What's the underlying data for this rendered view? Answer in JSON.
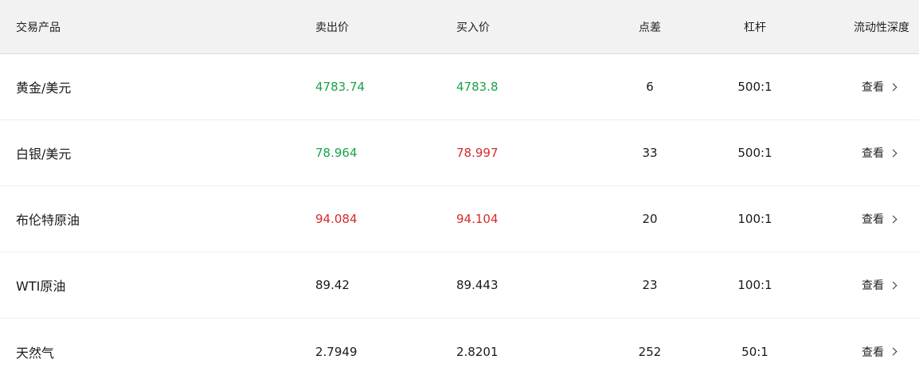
{
  "header": {
    "product": "交易产品",
    "sell": "卖出价",
    "buy": "买入价",
    "spread": "点差",
    "leverage": "杠杆",
    "depth": "流动性深度"
  },
  "colors": {
    "up": "#19a34a",
    "down": "#d42b2b",
    "neutral": "#1a1a1a"
  },
  "rows": [
    {
      "name": "黄金/美元",
      "sell": "4783.74",
      "sell_trend": "up",
      "buy": "4783.8",
      "buy_trend": "up",
      "spread": "6",
      "leverage": "500:1",
      "link": "查看"
    },
    {
      "name": "白银/美元",
      "sell": "78.964",
      "sell_trend": "up",
      "buy": "78.997",
      "buy_trend": "down",
      "spread": "33",
      "leverage": "500:1",
      "link": "查看"
    },
    {
      "name": "布伦特原油",
      "sell": "94.084",
      "sell_trend": "down",
      "buy": "94.104",
      "buy_trend": "down",
      "spread": "20",
      "leverage": "100:1",
      "link": "查看"
    },
    {
      "name": "WTI原油",
      "sell": "89.42",
      "sell_trend": "neutral",
      "buy": "89.443",
      "buy_trend": "neutral",
      "spread": "23",
      "leverage": "100:1",
      "link": "查看"
    },
    {
      "name": "天然气",
      "sell": "2.7949",
      "sell_trend": "neutral",
      "buy": "2.8201",
      "buy_trend": "neutral",
      "spread": "252",
      "leverage": "50:1",
      "link": "查看"
    }
  ]
}
